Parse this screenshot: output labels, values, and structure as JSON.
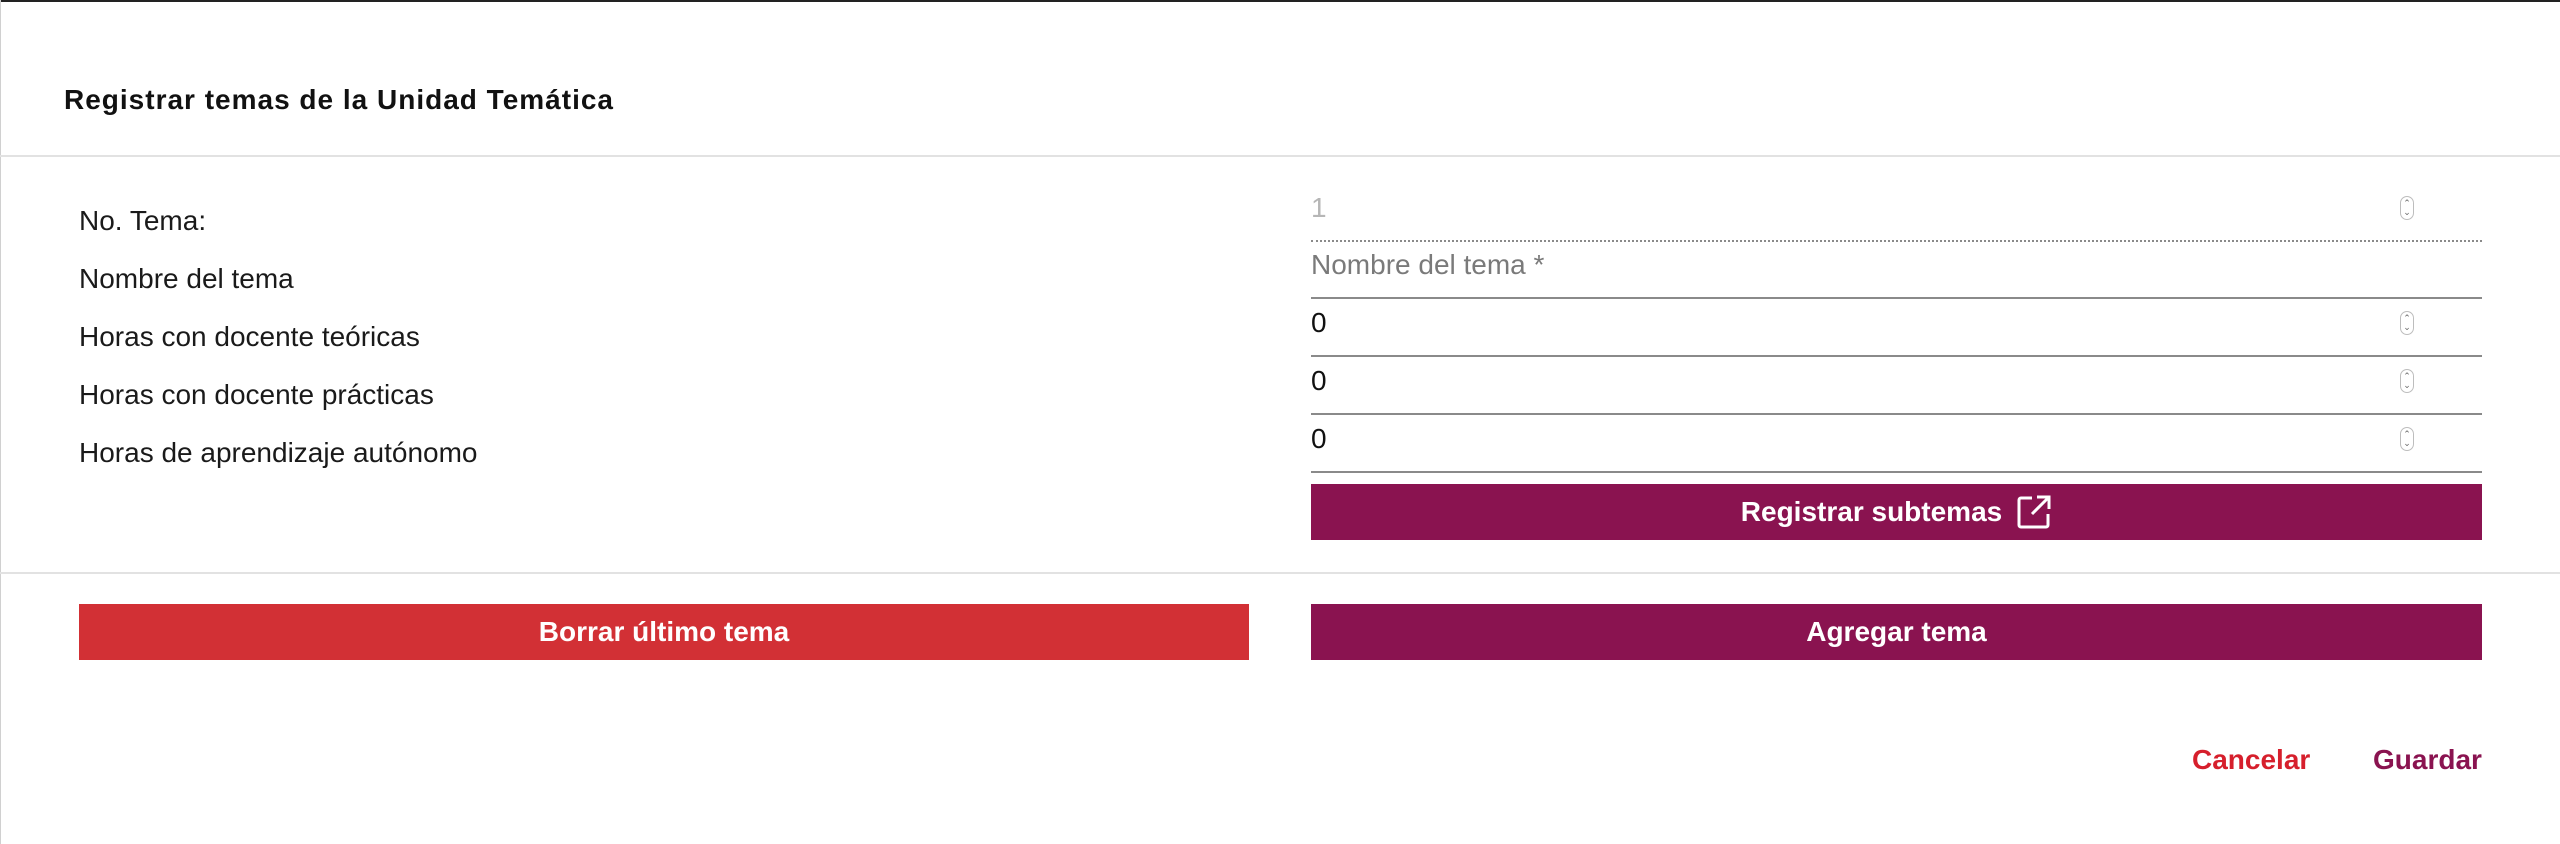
{
  "dialog": {
    "title": "Registrar temas de la Unidad Temática"
  },
  "form": {
    "topic_number": {
      "label": "No. Tema:",
      "value": "1"
    },
    "topic_name": {
      "label": "Nombre del tema",
      "placeholder": "Nombre del tema *",
      "value": ""
    },
    "theory_hours": {
      "label": "Horas con docente teóricas",
      "value": "0"
    },
    "practice_hours": {
      "label": "Horas con docente prácticas",
      "value": "0"
    },
    "autonomous_hours": {
      "label": "Horas de aprendizaje autónomo",
      "value": "0"
    }
  },
  "buttons": {
    "register_subtopics": "Registrar subtemas",
    "delete_last_topic": "Borrar último tema",
    "add_topic": "Agregar tema",
    "cancel": "Cancelar",
    "save": "Guardar"
  },
  "icons": {
    "register_subtopics": "open-in-new-icon",
    "spinner": "number-spinner-icon"
  },
  "colors": {
    "primary": "#8a1350",
    "danger": "#d23035",
    "cancel_text": "#d61f2c",
    "save_text": "#8a1350"
  }
}
